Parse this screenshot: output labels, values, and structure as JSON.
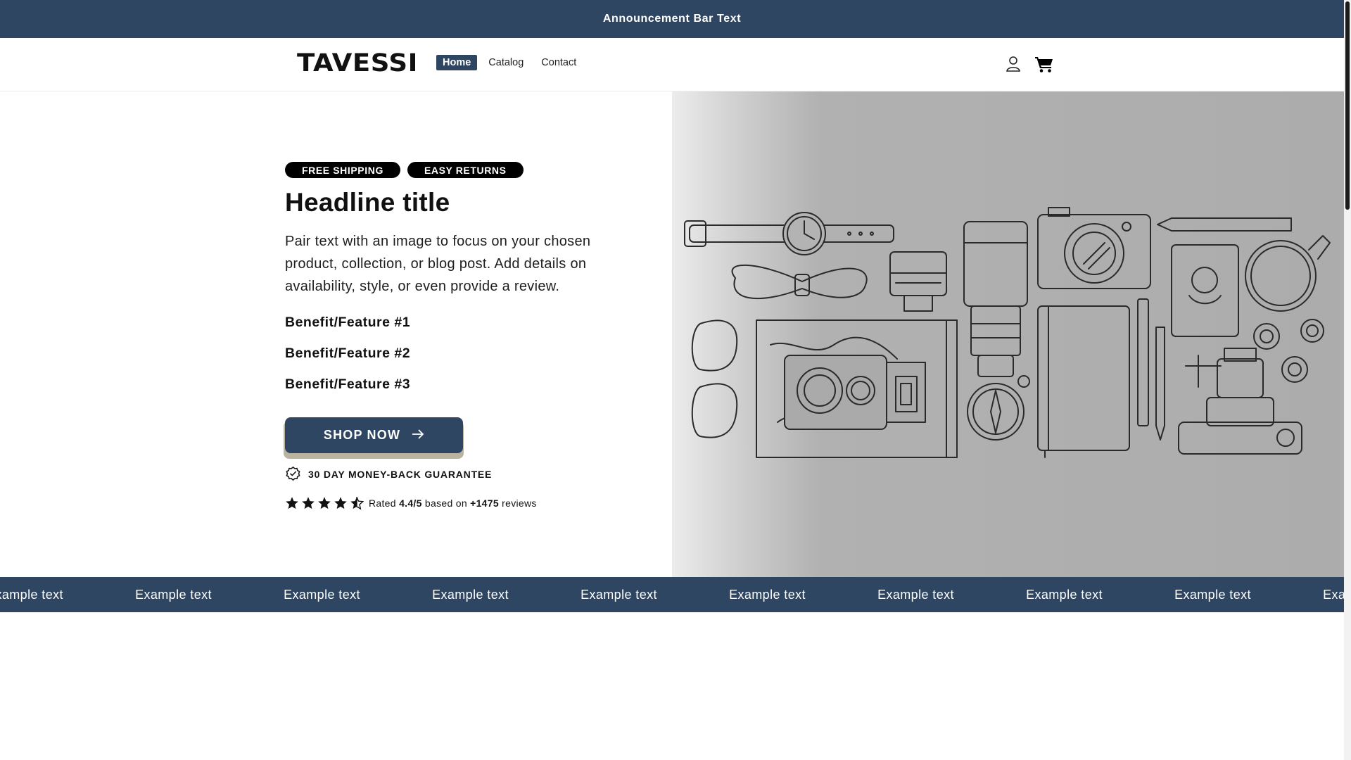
{
  "announcement": {
    "text": "Announcement Bar Text"
  },
  "header": {
    "logo": "TAVESSI",
    "nav": [
      {
        "label": "Home",
        "active": true
      },
      {
        "label": "Catalog",
        "active": false
      },
      {
        "label": "Contact",
        "active": false
      }
    ],
    "icons": [
      "account-icon",
      "cart-icon"
    ]
  },
  "hero": {
    "badges": [
      "FREE SHIPPING",
      "EASY RETURNS"
    ],
    "headline": "Headline title",
    "description": "Pair text with an image to focus on your chosen product, collection, or blog post. Add details on availability, style, or even provide a review.",
    "features": [
      "Benefit/Feature #1",
      "Benefit/Feature #2",
      "Benefit/Feature #3"
    ],
    "cta_label": "SHOP NOW",
    "guarantee": "30 DAY MONEY-BACK GUARANTEE",
    "rating": {
      "prefix": "Rated",
      "score": "4.4/5",
      "middle": "based on",
      "count": "+1475",
      "suffix": "reviews",
      "stars": 4.5
    }
  },
  "marquee": {
    "items": [
      "Example text",
      "Example text",
      "Example text",
      "Example text",
      "Example text",
      "Example text",
      "Example text",
      "Example text",
      "Example text",
      "Example text"
    ]
  },
  "colors": {
    "brand_navy": "#2f4663",
    "button_shadow": "#bab39f",
    "hero_image_bg": "#acacac",
    "text": "#121212"
  }
}
